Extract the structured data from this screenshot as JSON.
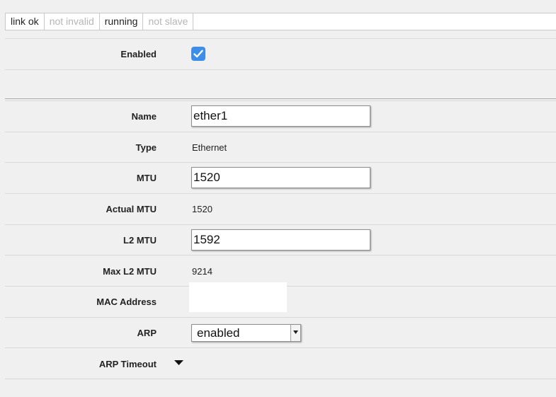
{
  "status_flags": [
    {
      "label": "link ok",
      "active": true
    },
    {
      "label": "not invalid",
      "active": false
    },
    {
      "label": "running",
      "active": true
    },
    {
      "label": "not slave",
      "active": false
    }
  ],
  "fields": {
    "enabled": {
      "label": "Enabled",
      "checked": true
    },
    "name": {
      "label": "Name",
      "value": "ether1"
    },
    "type": {
      "label": "Type",
      "value": "Ethernet"
    },
    "mtu": {
      "label": "MTU",
      "value": "1520"
    },
    "actual_mtu": {
      "label": "Actual MTU",
      "value": "1520"
    },
    "l2_mtu": {
      "label": "L2 MTU",
      "value": "1592"
    },
    "max_l2_mtu": {
      "label": "Max L2 MTU",
      "value": "9214"
    },
    "mac_address": {
      "label": "MAC Address",
      "value": ""
    },
    "arp": {
      "label": "ARP",
      "value": "enabled"
    },
    "arp_timeout": {
      "label": "ARP Timeout",
      "icon": "triangle-down-icon"
    }
  },
  "colors": {
    "checkbox_accent": "#3d8ee8",
    "background": "#f0f0f0"
  }
}
